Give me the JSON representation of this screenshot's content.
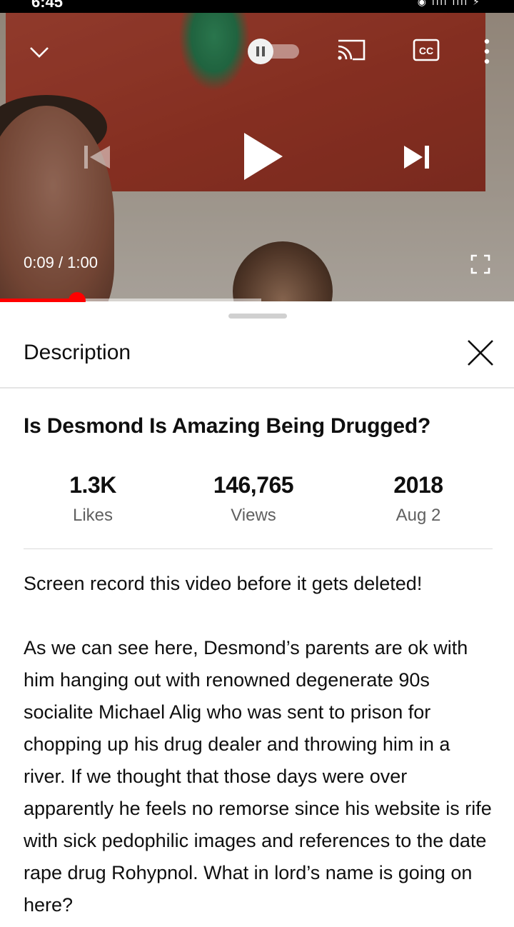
{
  "status_bar": {
    "time": "6:45",
    "icons": "◉ ıılı ıılı ⚡"
  },
  "player": {
    "time_current": "0:09",
    "time_total": "1:00",
    "progress": 0.15,
    "buffered": 0.508
  },
  "sheet": {
    "title": "Description",
    "video_title": "Is Desmond Is Amazing Being Drugged?",
    "stats": [
      {
        "value": "1.3K",
        "label": "Likes"
      },
      {
        "value": "146,765",
        "label": "Views"
      },
      {
        "value": "2018",
        "label": "Aug 2"
      }
    ],
    "description": [
      "Screen record this video before it gets deleted!",
      "As we can see here, Desmond’s parents are ok with him hanging out with renowned degenerate 90s socialite Michael Alig who was sent to prison for chopping up his drug dealer and throwing him in a river. If we thought that those days were over apparently he feels no remorse since his website is rife with sick pedophilic images and references to the date rape drug Rohypnol. What in lord’s name is going on here?"
    ]
  },
  "colors": {
    "progress_played": "#ff0000",
    "text_secondary": "#606060"
  }
}
